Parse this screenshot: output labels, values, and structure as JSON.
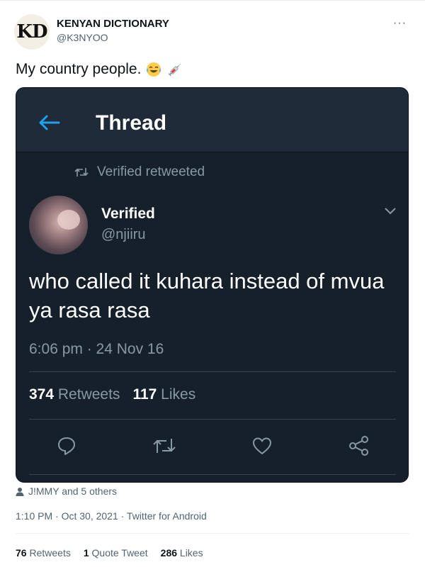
{
  "author": {
    "avatar_text": "KD",
    "name": "KENYAN DICTIONARY",
    "handle": "@K3NYOO"
  },
  "more_icon": "···",
  "tweet_text": "My country people.",
  "tweet_emojis": [
    "face-with-tears-of-joy-icon",
    "syringe-icon"
  ],
  "screenshot": {
    "header_title": "Thread",
    "retweet_context": "Verified retweeted",
    "name": "Verified",
    "handle": "@njiiru",
    "text": "who called it kuhara instead of mvua ya rasa rasa",
    "time": "6:06 pm · 24 Nov 16",
    "retweets_count": "374",
    "retweets_label": "Retweets",
    "likes_count": "117",
    "likes_label": "Likes",
    "bg_color": "#15202b",
    "header_color": "#1f2b38",
    "accent": "#1da1f2"
  },
  "liked_by": "J!MMY and 5 others",
  "meta": "1:10 PM · Oct 30, 2021 · Twitter for Android",
  "counts": {
    "retweets_count": "76",
    "retweets_label": "Retweets",
    "quote_count": "1",
    "quote_label": "Quote Tweet",
    "likes_count": "286",
    "likes_label": "Likes"
  }
}
